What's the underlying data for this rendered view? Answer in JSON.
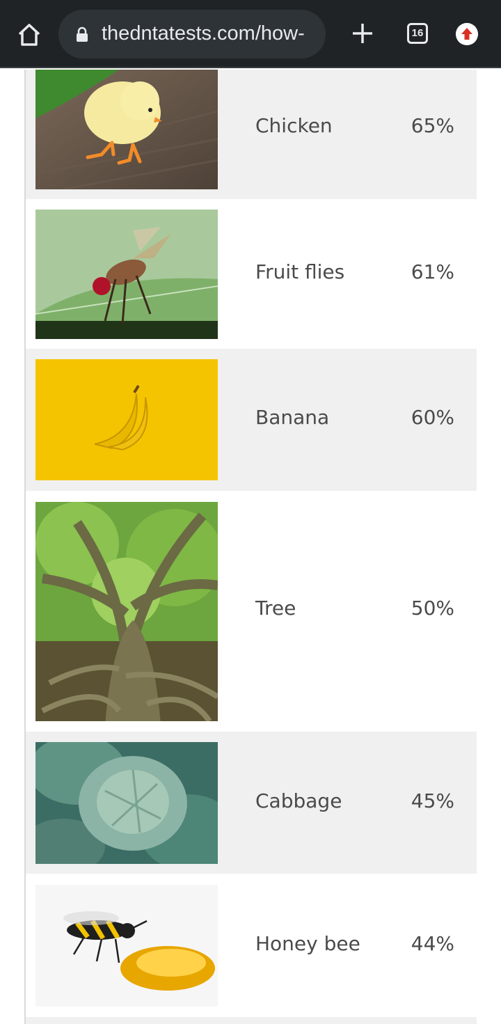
{
  "browser": {
    "url": "thedntatests.com/how-",
    "tab_count": "16"
  },
  "rows": [
    {
      "name": "Chicken",
      "percent": "65%",
      "image": "chicken-photo"
    },
    {
      "name": "Fruit flies",
      "percent": "61%",
      "image": "fruit-fly-photo"
    },
    {
      "name": "Banana",
      "percent": "60%",
      "image": "banana-photo"
    },
    {
      "name": "Tree",
      "percent": "50%",
      "image": "tree-photo"
    },
    {
      "name": "Cabbage",
      "percent": "45%",
      "image": "cabbage-photo"
    },
    {
      "name": "Honey bee",
      "percent": "44%",
      "image": "honey-bee-photo"
    }
  ],
  "colors": {
    "toolbar": "#1f2326",
    "row_shade": "#f0f0f0",
    "text": "#4a4a4a"
  }
}
